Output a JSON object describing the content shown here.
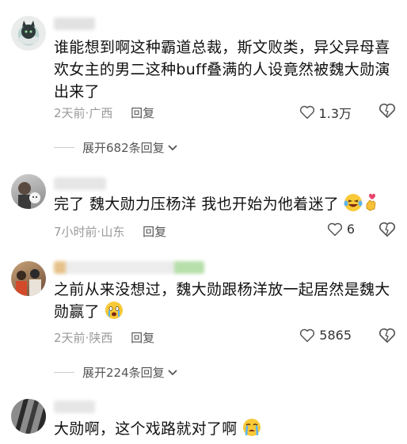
{
  "comments": [
    {
      "text": "谁能想到啊这种霸道总裁，斯文败类，异父异母喜欢女主的男二这种buff叠满的人设竟然被魏大勋演出来了",
      "time": "2天前",
      "location": "广西",
      "reply_label": "回复",
      "likes": "1.3万",
      "expand_label": "展开682条回复"
    },
    {
      "text": "完了 魏大勋力压杨洋 我也开始为他着迷了",
      "time": "7小时前",
      "location": "山东",
      "reply_label": "回复",
      "likes": "6"
    },
    {
      "text": "之前从来没想过，魏大勋跟杨洋放一起居然是魏大勋赢了",
      "time": "2天前",
      "location": "陕西",
      "reply_label": "回复",
      "likes": "5865",
      "expand_label": "展开224条回复"
    },
    {
      "text": "大勋啊，这个戏路就对了啊"
    }
  ],
  "separator": "·",
  "colors": {
    "meta": "#9a9a9a",
    "text": "#111111"
  },
  "icons": [
    "heart-outline-icon",
    "dislike-heart-icon",
    "chevron-down-icon"
  ]
}
